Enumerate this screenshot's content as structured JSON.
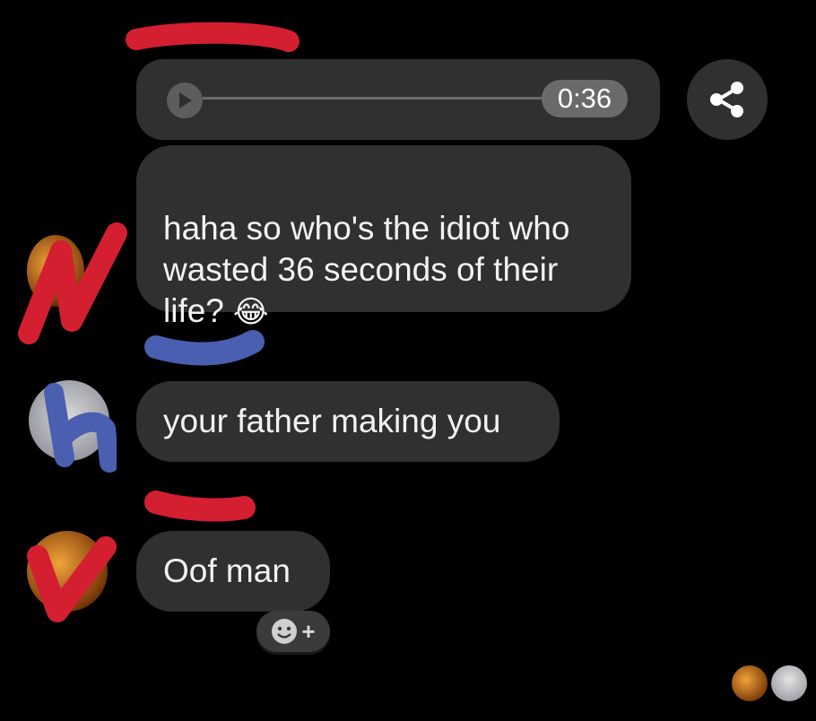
{
  "audio_message": {
    "duration": "0:36"
  },
  "messages": [
    {
      "text": "haha so who's the idiot who\nwasted 36 seconds of their\nlife?",
      "emoji": "😂"
    },
    {
      "text": "your father making you"
    },
    {
      "text": "Oof man"
    }
  ],
  "icons": {
    "play": "play-icon",
    "share": "share-icon",
    "add_reaction": "add-reaction-icon"
  },
  "colors": {
    "background": "#000000",
    "bubble": "#303030",
    "redaction_red": "#d31f30",
    "redaction_blue": "#4b5fb0"
  }
}
